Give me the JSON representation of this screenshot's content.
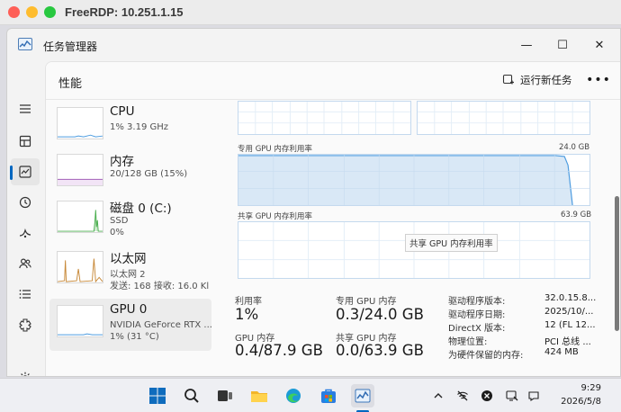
{
  "mac": {
    "title": "FreeRDP: 10.251.1.15"
  },
  "window": {
    "title": "任务管理器",
    "controls": {
      "minimize": "—",
      "maximize": "☐",
      "close": "✕"
    }
  },
  "header": {
    "page_title": "性能",
    "run_task": "运行新任务",
    "more": "•••"
  },
  "nav": {
    "items": [
      "hamburger-icon",
      "processes-icon",
      "performance-icon",
      "app-history-icon",
      "startup-icon",
      "users-icon",
      "details-icon",
      "services-icon",
      "settings-icon"
    ],
    "active_index": 2
  },
  "devices": [
    {
      "name": "CPU",
      "sub1": "1% 3.19 GHz",
      "sub2": ""
    },
    {
      "name": "内存",
      "sub1": "20/128 GB (15%)",
      "sub2": ""
    },
    {
      "name": "磁盘 0 (C:)",
      "sub1": "SSD",
      "sub2": "0%"
    },
    {
      "name": "以太网",
      "sub1": "以太网 2",
      "sub2": "发送: 168 接收: 16.0 Kl"
    },
    {
      "name": "GPU 0",
      "sub1": "NVIDIA GeForce RTX ...",
      "sub2": "1% (31 °C)"
    }
  ],
  "selected_device": 4,
  "graphs": {
    "dedicated_label": "专用 GPU 内存利用率",
    "dedicated_max": "24.0 GB",
    "shared_label": "共享 GPU 内存利用率",
    "shared_max": "63.9 GB",
    "shared_tooltip": "共享 GPU 内存利用率"
  },
  "stats": {
    "utilization_label": "利用率",
    "utilization_value": "1%",
    "dedicated_label": "专用 GPU 内存",
    "dedicated_value": "0.3/24.0 GB",
    "gpu_mem_label": "GPU 内存",
    "gpu_mem_value": "0.4/87.9 GB",
    "shared_label": "共享 GPU 内存",
    "shared_value": "0.0/63.9 GB"
  },
  "details": [
    {
      "label": "驱动程序版本:",
      "value": "32.0.15.8..."
    },
    {
      "label": "驱动程序日期:",
      "value": "2025/10/..."
    },
    {
      "label": "DirectX 版本:",
      "value": "12 (FL 12..."
    },
    {
      "label": "物理位置:",
      "value": "PCI 总线 ..."
    },
    {
      "label": "为硬件保留的内存:",
      "value": "424 MB"
    }
  ],
  "taskbar": {
    "apps": [
      "windows-start-icon",
      "search-icon",
      "task-view-icon",
      "file-explorer-icon",
      "edge-icon",
      "store-icon",
      "task-manager-icon"
    ],
    "tray": [
      "chevron-up-icon",
      "network-off-icon",
      "sound-off-icon",
      "remote-icon",
      "notification-icon"
    ],
    "time": "9:29",
    "date": "2026/5/8"
  },
  "colors": {
    "accent": "#0067c0",
    "gpu_graph": "#4d9ce0",
    "memory_graph": "#a25fb8",
    "disk_graph": "#4caf50",
    "ethernet_graph": "#c88a3a"
  }
}
